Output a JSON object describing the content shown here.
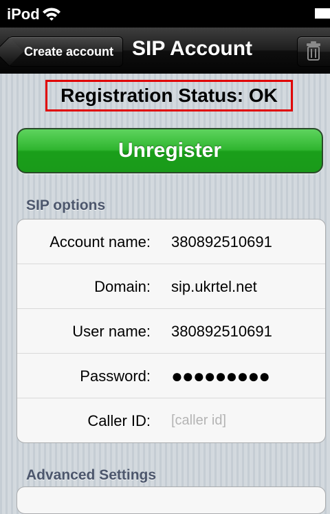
{
  "status_bar": {
    "carrier": "iPod"
  },
  "nav": {
    "back_label": "Create account",
    "title": "SIP Account"
  },
  "registration_status": "Registration Status: OK",
  "unregister_label": "Unregister",
  "colors": {
    "highlight_border": "#e00000",
    "button_green": "#2fb52f",
    "section_header": "#4c566c"
  },
  "sip_options": {
    "header": "SIP options",
    "rows": [
      {
        "label": "Account name:",
        "value": "380892510691"
      },
      {
        "label": "Domain:",
        "value": "sip.ukrtel.net"
      },
      {
        "label": "User name:",
        "value": "380892510691"
      },
      {
        "label": "Password:",
        "value": "●●●●●●●●●"
      },
      {
        "label": "Caller ID:",
        "placeholder": "[caller id]"
      }
    ]
  },
  "advanced": {
    "header": "Advanced Settings"
  },
  "icons": [
    "wifi-icon",
    "battery-icon",
    "trash-icon"
  ]
}
